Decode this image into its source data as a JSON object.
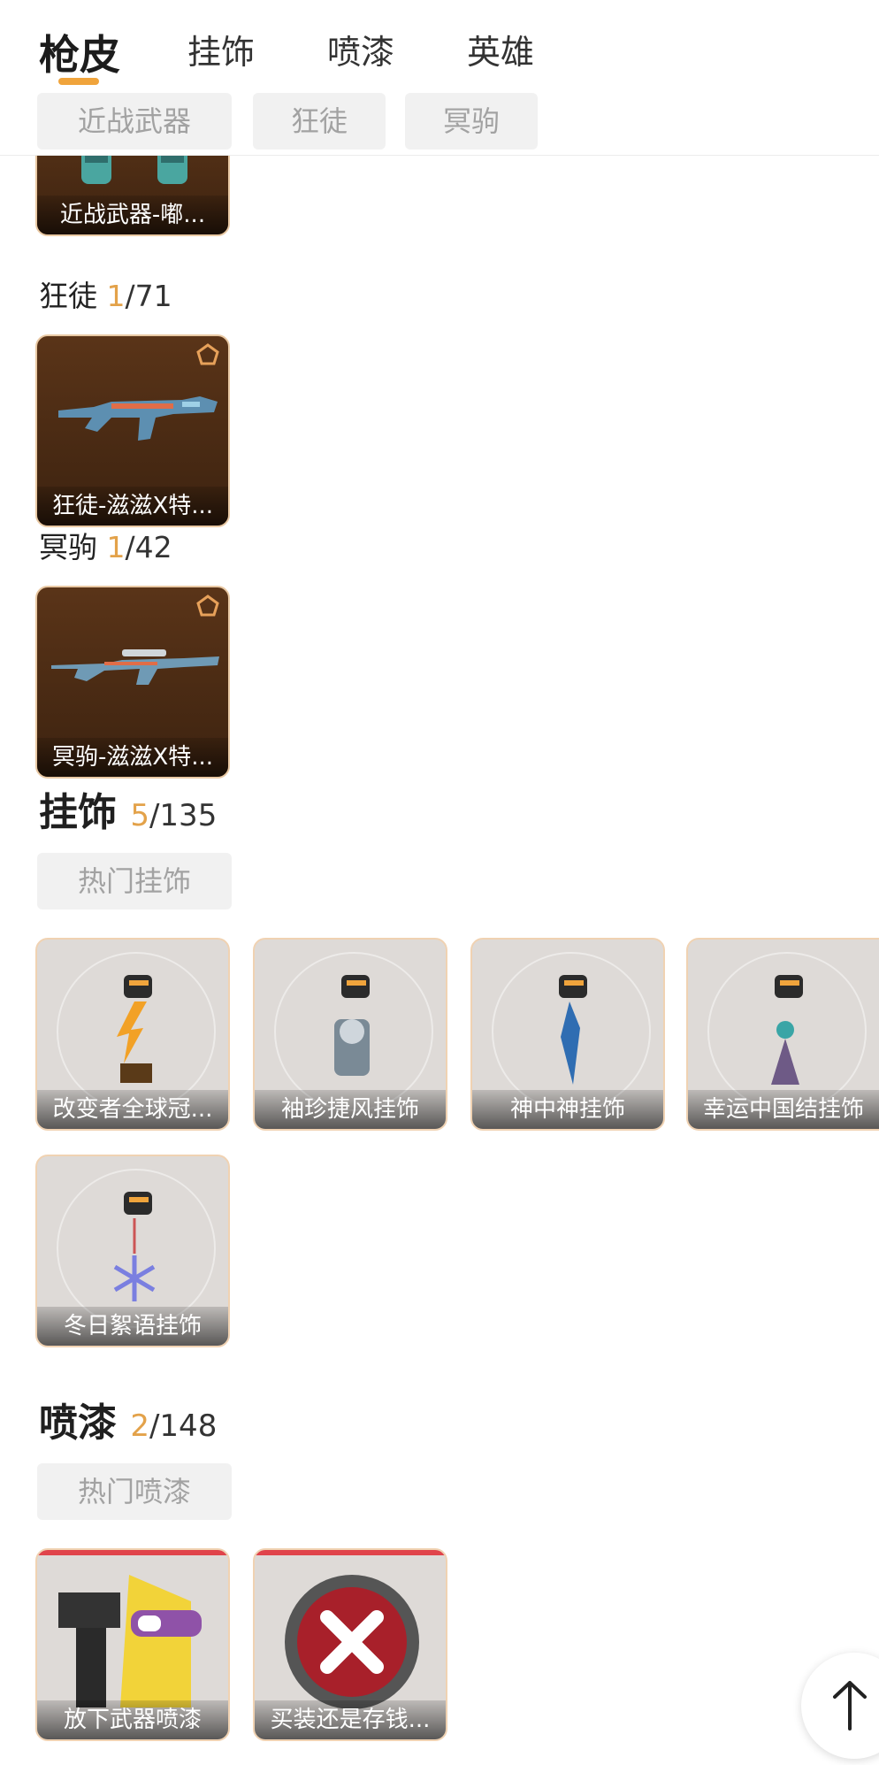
{
  "tabs": [
    "枪皮",
    "挂饰",
    "喷漆",
    "英雄"
  ],
  "weapon_filters": [
    "近战武器",
    "狂徒",
    "冥驹"
  ],
  "melee": {
    "card_label": "近战武器-嘟..."
  },
  "vandal": {
    "title": "狂徒",
    "owned": "1",
    "total": "/71",
    "card_label": "狂徒-滋滋X特..."
  },
  "operator": {
    "title": "冥驹",
    "owned": "1",
    "total": "/42",
    "card_label": "冥驹-滋滋X特..."
  },
  "charms": {
    "title": "挂饰",
    "owned": "5",
    "total": "/135",
    "filter": "热门挂饰",
    "items": [
      "改变者全球冠...",
      "袖珍捷风挂饰",
      "神中神挂饰",
      "幸运中国结挂饰",
      "冬日絮语挂饰"
    ]
  },
  "sprays": {
    "title": "喷漆",
    "owned": "2",
    "total": "/148",
    "filter": "热门喷漆",
    "items": [
      "放下武器喷漆",
      "买装还是存钱..."
    ]
  },
  "icons": {
    "rank": "rank-pentagon-icon",
    "back_to_top": "arrow-up-icon"
  },
  "colors": {
    "accent": "#f0a43c",
    "count": "#e3a24a",
    "spray_rarity": "#e0434a"
  }
}
